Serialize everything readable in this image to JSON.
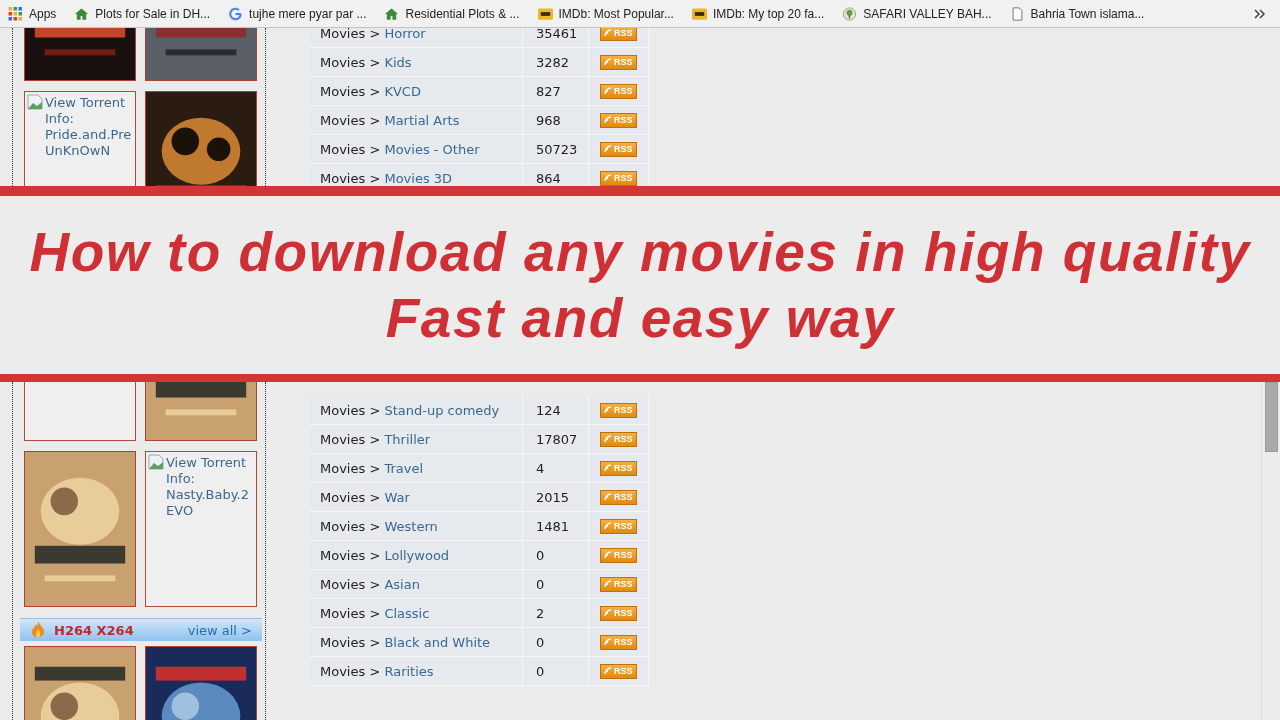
{
  "bookmarks": [
    {
      "kind": "apps",
      "label": "Apps"
    },
    {
      "kind": "house",
      "label": "Plots for Sale in DH..."
    },
    {
      "kind": "google",
      "label": "tujhe mere pyar par ..."
    },
    {
      "kind": "house",
      "label": "Residential Plots & ..."
    },
    {
      "kind": "imdb",
      "label": "IMDb: Most Popular..."
    },
    {
      "kind": "imdb",
      "label": "IMDb: My top 20 fa..."
    },
    {
      "kind": "tree",
      "label": "SAFARI VALLEY BAH..."
    },
    {
      "kind": "page",
      "label": "Bahria Town islama..."
    }
  ],
  "top": {
    "tiles": [
      {
        "kind": "picture"
      },
      {
        "kind": "picture"
      },
      {
        "kind": "broken",
        "alt_lines": [
          "View Torrent",
          "Info:",
          "Pride.and.Pre",
          "UnKnOwN"
        ]
      },
      {
        "kind": "picture"
      }
    ],
    "rows": [
      {
        "prefix": "Movies >",
        "name": "Horror",
        "count": "35461",
        "feed": "RSS"
      },
      {
        "prefix": "Movies >",
        "name": "Kids",
        "count": "3282",
        "feed": "RSS"
      },
      {
        "prefix": "Movies >",
        "name": "KVCD",
        "count": "827",
        "feed": "RSS"
      },
      {
        "prefix": "Movies >",
        "name": "Martial Arts",
        "count": "968",
        "feed": "RSS"
      },
      {
        "prefix": "Movies >",
        "name": "Movies - Other",
        "count": "50723",
        "feed": "RSS"
      },
      {
        "prefix": "Movies >",
        "name": "Movies 3D",
        "count": "864",
        "feed": "RSS"
      }
    ]
  },
  "banner": {
    "lines": [
      "How to download any movies in high quality",
      "Fast and easy way"
    ]
  },
  "bottom": {
    "tiles": [
      {
        "kind": "blank"
      },
      {
        "kind": "picture"
      },
      {
        "kind": "picture"
      },
      {
        "kind": "broken",
        "alt_lines": [
          "View Torrent",
          "Info:",
          "Nasty.Baby.2",
          "EVO"
        ]
      }
    ],
    "section": {
      "title": "H264 X264",
      "link": "view all >"
    },
    "more_tiles": [
      {
        "kind": "picture"
      },
      {
        "kind": "picture"
      }
    ],
    "rows": [
      {
        "prefix": "Movies >",
        "name": "Stand-up comedy",
        "count": "124",
        "feed": "RSS"
      },
      {
        "prefix": "Movies >",
        "name": "Thriller",
        "count": "17807",
        "feed": "RSS"
      },
      {
        "prefix": "Movies >",
        "name": "Travel",
        "count": "4",
        "feed": "RSS"
      },
      {
        "prefix": "Movies >",
        "name": "War",
        "count": "2015",
        "feed": "RSS"
      },
      {
        "prefix": "Movies >",
        "name": "Western",
        "count": "1481",
        "feed": "RSS"
      },
      {
        "prefix": "Movies >",
        "name": "Lollywood",
        "count": "0",
        "feed": "RSS"
      },
      {
        "prefix": "Movies >",
        "name": "Asian",
        "count": "0",
        "feed": "RSS"
      },
      {
        "prefix": "Movies >",
        "name": "Classic",
        "count": "2",
        "feed": "RSS"
      },
      {
        "prefix": "Movies >",
        "name": "Black and White",
        "count": "0",
        "feed": "RSS"
      },
      {
        "prefix": "Movies >",
        "name": "Rarities",
        "count": "0",
        "feed": "RSS"
      }
    ]
  }
}
